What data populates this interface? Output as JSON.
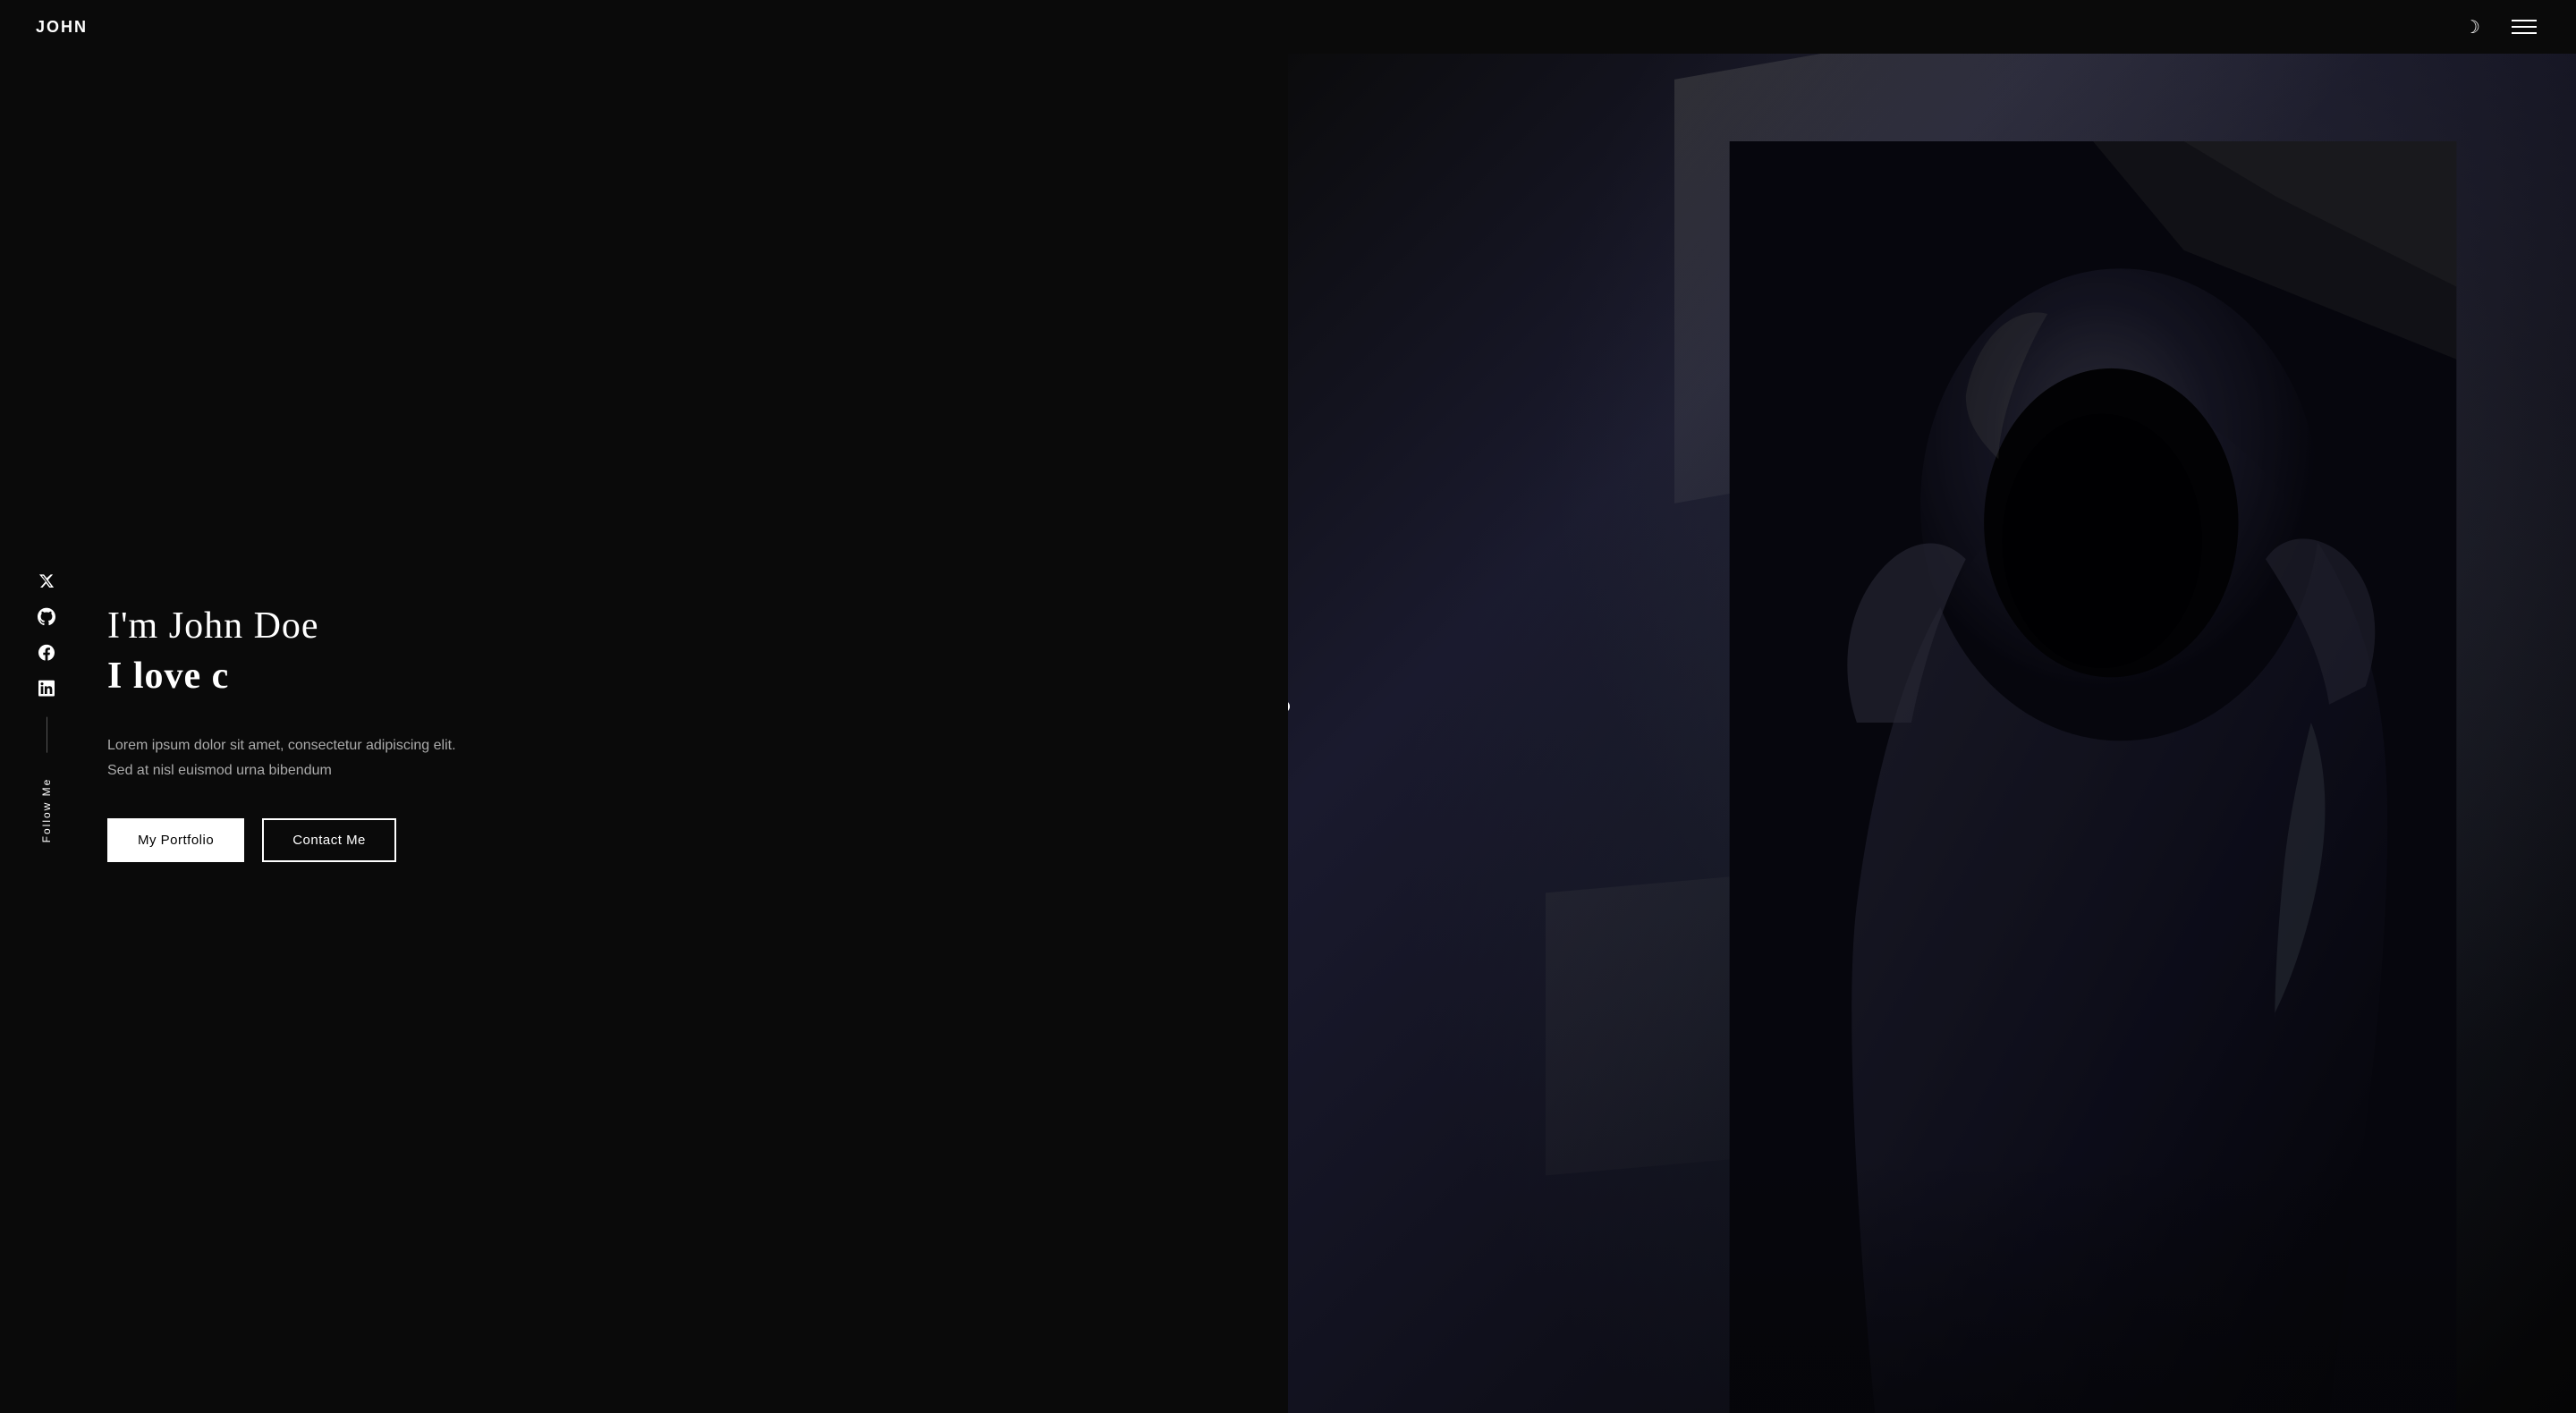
{
  "header": {
    "logo": "JOHN",
    "theme_toggle_label": "☽",
    "hamburger_lines": 3
  },
  "sidebar": {
    "follow_label": "Follow Me",
    "social_links": [
      {
        "name": "twitter",
        "icon": "twitter",
        "symbol": "𝕏"
      },
      {
        "name": "github",
        "icon": "github",
        "symbol": "⊙"
      },
      {
        "name": "facebook",
        "icon": "facebook",
        "symbol": "f"
      },
      {
        "name": "linkedin",
        "icon": "linkedin",
        "symbol": "in"
      }
    ]
  },
  "hero": {
    "greeting": "I'm John Doe",
    "tagline": "I love c",
    "description": "Lorem ipsum dolor sit amet, consectetur adipiscing elit. Sed at nisl euismod urna bibendum",
    "btn_portfolio": "My Portfolio",
    "btn_contact": "Contact Me"
  },
  "colors": {
    "bg": "#0a0a0a",
    "text": "#ffffff",
    "accent": "#ffffff",
    "muted": "#aaaaaa"
  }
}
